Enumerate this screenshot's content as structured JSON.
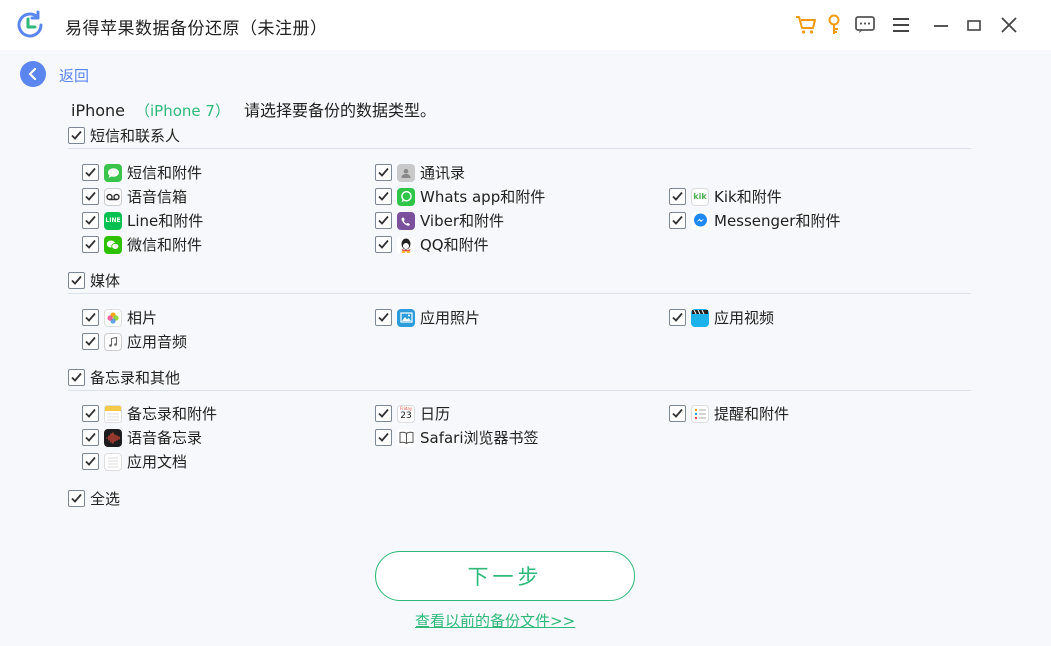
{
  "window": {
    "title": "易得苹果数据备份还原（未注册）",
    "accent": "#5b86ef",
    "brand_green": "#2eb97a",
    "toolbar_icons": [
      "cart-icon",
      "key-icon",
      "feedback-icon",
      "menu-icon",
      "minimize-icon",
      "maximize-icon",
      "close-icon"
    ]
  },
  "nav": {
    "back_label": "返回"
  },
  "device": {
    "name": "iPhone",
    "model": "（iPhone 7）",
    "prompt": "请选择要备份的数据类型。"
  },
  "sections": [
    {
      "label": "短信和联系人",
      "checked": true,
      "items": [
        {
          "label": "短信和附件",
          "icon": "messages-icon",
          "checked": true
        },
        {
          "label": "通讯录",
          "icon": "contacts-icon",
          "checked": true
        },
        {
          "label": "语音信箱",
          "icon": "voicemail-icon",
          "checked": true
        },
        {
          "label": "Whats app和附件",
          "icon": "whatsapp-icon",
          "checked": true
        },
        {
          "label": "Kik和附件",
          "icon": "kik-icon",
          "checked": true
        },
        {
          "label": "Line和附件",
          "icon": "line-icon",
          "checked": true
        },
        {
          "label": "Viber和附件",
          "icon": "viber-icon",
          "checked": true
        },
        {
          "label": "Messenger和附件",
          "icon": "messenger-icon",
          "checked": true
        },
        {
          "label": "微信和附件",
          "icon": "wechat-icon",
          "checked": true
        },
        {
          "label": "QQ和附件",
          "icon": "qq-icon",
          "checked": true
        }
      ]
    },
    {
      "label": "媒体",
      "checked": true,
      "items": [
        {
          "label": "相片",
          "icon": "photos-icon",
          "checked": true
        },
        {
          "label": "应用照片",
          "icon": "app-photos-icon",
          "checked": true
        },
        {
          "label": "应用视频",
          "icon": "app-video-icon",
          "checked": true
        },
        {
          "label": "应用音频",
          "icon": "app-audio-icon",
          "checked": true
        }
      ]
    },
    {
      "label": "备忘录和其他",
      "checked": true,
      "items": [
        {
          "label": "备忘录和附件",
          "icon": "notes-icon",
          "checked": true
        },
        {
          "label": "日历",
          "icon": "calendar-icon",
          "checked": true,
          "icon_text": {
            "day": "Friday",
            "date": "23"
          }
        },
        {
          "label": "提醒和附件",
          "icon": "reminders-icon",
          "checked": true
        },
        {
          "label": "语音备忘录",
          "icon": "voice-memo-icon",
          "checked": true
        },
        {
          "label": "Safari浏览器书签",
          "icon": "safari-bookmarks-icon",
          "checked": true
        },
        {
          "label": "应用文档",
          "icon": "app-documents-icon",
          "checked": true
        }
      ]
    }
  ],
  "select_all": {
    "label": "全选",
    "checked": true
  },
  "actions": {
    "next_label": "下一步",
    "history_link": "查看以前的备份文件>>"
  }
}
